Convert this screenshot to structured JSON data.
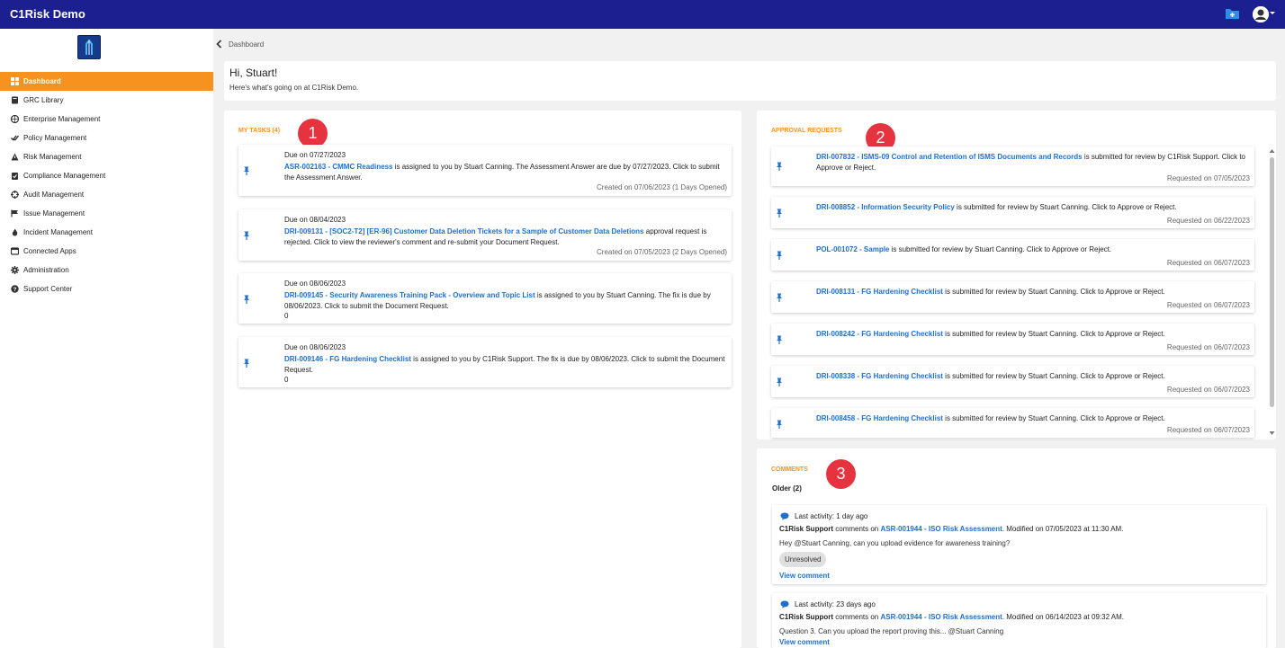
{
  "app": {
    "title": "C1Risk Demo"
  },
  "sidebar": {
    "items": [
      {
        "label": "Dashboard"
      },
      {
        "label": "GRC Library"
      },
      {
        "label": "Enterprise Management"
      },
      {
        "label": "Policy Management"
      },
      {
        "label": "Risk Management"
      },
      {
        "label": "Compliance Management"
      },
      {
        "label": "Audit Management"
      },
      {
        "label": "Issue Management"
      },
      {
        "label": "Incident Management"
      },
      {
        "label": "Connected Apps"
      },
      {
        "label": "Administration"
      },
      {
        "label": "Support Center"
      }
    ]
  },
  "breadcrumb": "Dashboard",
  "greeting": {
    "title": "Hi, Stuart!",
    "subtitle": "Here's what's going on at C1Risk Demo."
  },
  "markers": [
    "1",
    "2",
    "3"
  ],
  "tasks": {
    "title": "MY TASKS (4)",
    "items": [
      {
        "due": "Due on 07/27/2023",
        "link": "ASR-002163 - CMMC Readiness",
        "text": " is assigned to you by Stuart Canning. The Assessment Answer are due by 07/27/2023. Click to submit the Assessment Answer.",
        "created": "Created on 07/06/2023 (1 Days Opened)"
      },
      {
        "due": "Due on 08/04/2023",
        "link": "DRI-009131 - [SOC2-T2] [ER-96] Customer Data Deletion Tickets for a Sample of Customer Data Deletions",
        "text": " approval request is rejected. Click to view the reviewer's comment and re-submit your Document Request.",
        "created": "Created on 07/05/2023 (2 Days Opened)"
      },
      {
        "due": "Due on 08/06/2023",
        "link": "DRI-009145 - Security Awareness Training Pack - Overview and Topic List",
        "text": " is assigned to you by Stuart Canning. The fix is due by 08/06/2023. Click to submit the Document Request.",
        "extra": "0"
      },
      {
        "due": "Due on 08/06/2023",
        "link": "DRI-009146 - FG Hardening Checklist",
        "text": " is assigned to you by C1Risk Support. The fix is due by 08/06/2023. Click to submit the Document Request.",
        "extra": "0"
      }
    ]
  },
  "approvals": {
    "title": "APPROVAL REQUESTS",
    "items": [
      {
        "link": "DRI-007832 - ISMS-09 Control and Retention of ISMS Documents and Records",
        "text": " is submitted for review by C1Risk Support. Click to Approve or Reject.",
        "requested": "Requested on 07/05/2023"
      },
      {
        "link": "DRI-008852 - Information Security Policy",
        "text": " is submitted for review by Stuart Canning. Click to Approve or Reject.",
        "requested": "Requested on 06/22/2023"
      },
      {
        "link": "POL-001072 - Sample",
        "text": " is submitted for review by Stuart Canning. Click to Approve or Reject.",
        "requested": "Requested on 06/07/2023"
      },
      {
        "link": "DRI-008131 - FG Hardening Checklist",
        "text": " is submitted for review by Stuart Canning. Click to Approve or Reject.",
        "requested": "Requested on 06/07/2023"
      },
      {
        "link": "DRI-008242 - FG Hardening Checklist",
        "text": " is submitted for review by Stuart Canning. Click to Approve or Reject.",
        "requested": "Requested on 06/07/2023"
      },
      {
        "link": "DRI-008338 - FG Hardening Checklist",
        "text": " is submitted for review by Stuart Canning. Click to Approve or Reject.",
        "requested": "Requested on 06/07/2023"
      },
      {
        "link": "DRI-008458 - FG Hardening Checklist",
        "text": " is submitted for review by Stuart Canning. Click to Approve or Reject.",
        "requested": "Requested on 06/07/2023"
      }
    ]
  },
  "comments": {
    "title": "COMMENTS",
    "older": "Older (2)",
    "items": [
      {
        "activity": "Last activity: 1 day ago",
        "author": "C1Risk Support",
        "mid": " comments on ",
        "link": "ASR-001944 - ISO Risk Assessment",
        "modified": ". Modified on 07/05/2023 at 11:30 AM.",
        "body": "Hey @Stuart Canning, can you upload evidence for awareness training?",
        "status": "Unresolved",
        "view": "View comment"
      },
      {
        "activity": "Last activity: 23 days ago",
        "author": "C1Risk Support",
        "mid": " comments on ",
        "link": "ASR-001944 - ISO Risk Assessment",
        "modified": ". Modified on 06/14/2023 at 09:32 AM.",
        "body": "Question 3. Can you upload the report proving this... @Stuart Canning",
        "view": "View comment"
      }
    ]
  },
  "colors": {
    "topbar": "#1b1f8f",
    "accent": "#f7921e",
    "link": "#1e6fd0",
    "marker": "#e53340"
  }
}
